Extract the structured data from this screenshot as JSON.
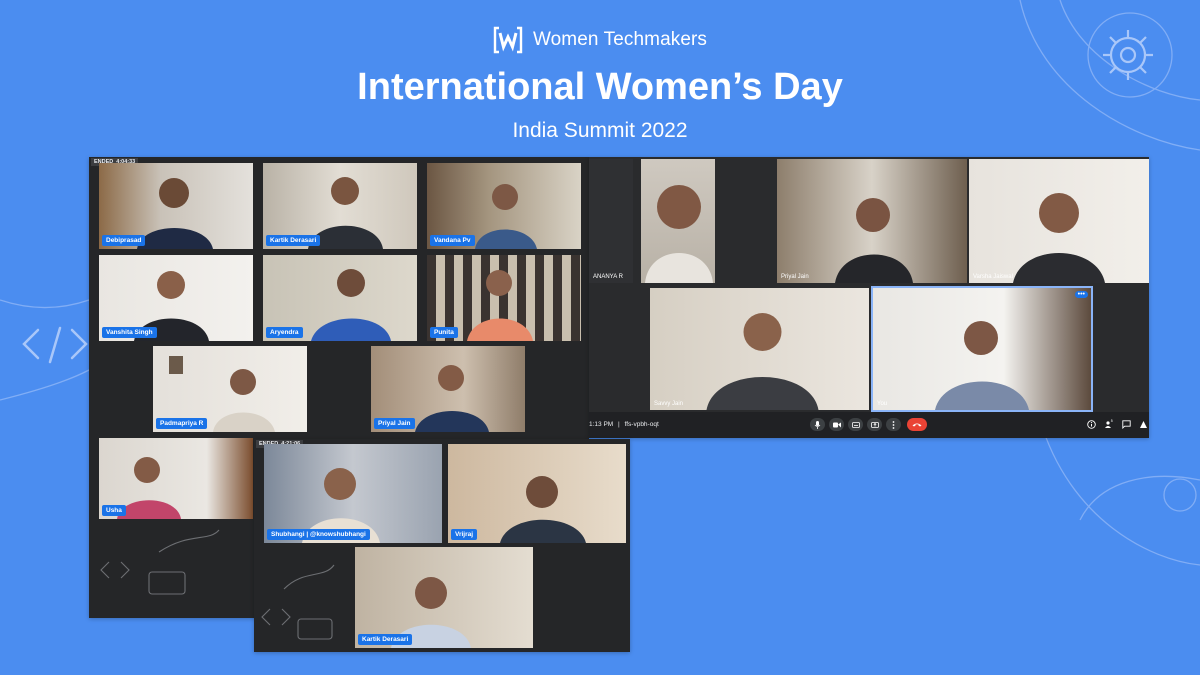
{
  "header": {
    "brand": "Women Techmakers",
    "title": "International Women’s Day",
    "subtitle": "India Summit 2022"
  },
  "panel_a": {
    "ended_label": "ENDED",
    "ended_time": "4:04:33",
    "participants": [
      "Debiprasad",
      "Kartik Derasari",
      "Vandana Pv",
      "Vanshita Singh",
      "Aryendra",
      "Punita",
      "Padmapriya R",
      "Priyal Jain",
      "Usha"
    ]
  },
  "panel_b": {
    "participants": [
      "ANANYA R",
      "Priyal Jain",
      "Varsha Jaiswal",
      "Savvy Jain",
      "You"
    ],
    "time": "1:13 PM",
    "separator": "|",
    "meeting_code": "ffs-vpbh-oqt",
    "people_count": "5"
  },
  "panel_c": {
    "ended_label": "ENDED",
    "ended_time": "4:21:06",
    "participants": [
      "Shubhangi | @knowshubhangi",
      "Vrijraj",
      "Kartik Derasari"
    ]
  },
  "icons": [
    "women-techmakers-logo-icon",
    "gear-icon",
    "code-brackets-icon",
    "mic-icon",
    "camera-icon",
    "captions-icon",
    "present-icon",
    "more-options-icon",
    "end-call-icon",
    "info-icon",
    "people-icon",
    "chat-icon",
    "activities-icon"
  ],
  "colors": {
    "background": "#4b8df0",
    "panel": "#252628",
    "name_chip": "#1a73e8",
    "end_call": "#ea4335"
  }
}
